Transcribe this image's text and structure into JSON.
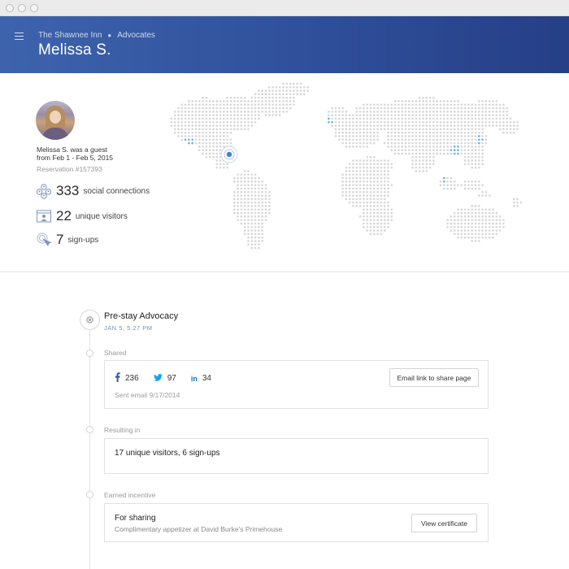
{
  "header": {
    "breadcrumb": [
      "The Shawnee Inn",
      "Advocates"
    ],
    "title": "Melissa S."
  },
  "profile": {
    "guest_line_1": "Melissa S. was a guest",
    "guest_line_2": "from Feb 1 - Feb 5, 2015",
    "reservation": "Reservation #157393",
    "stats": [
      {
        "number": "333",
        "label": "social connections",
        "icon": "people-icon"
      },
      {
        "number": "22",
        "label": "unique visitors",
        "icon": "visitor-card-icon"
      },
      {
        "number": "7",
        "label": "sign-ups",
        "icon": "cursor-click-icon"
      }
    ]
  },
  "map": {
    "icon": "world-dot-map",
    "dot_color": "#d8d8d8",
    "highlight_color": "#6fb2e8",
    "marker_color": "#3b82d6"
  },
  "timeline": {
    "title": "Pre-stay Advocacy",
    "date": "JAN 5, 5:27 PM",
    "sections": {
      "shared": {
        "label": "Shared",
        "facebook": "236",
        "twitter": "97",
        "linkedin": "34",
        "sent": "Sent email 9/17/2014",
        "button": "Email link to share page"
      },
      "resulting": {
        "label": "Resulting in",
        "text": "17 unique visitors, 6 sign-ups"
      },
      "incentive": {
        "label": "Earned incentive",
        "title": "For sharing",
        "desc": "Complimentary appetizer at David Burke's Primehouse",
        "button": "View certificate"
      }
    }
  },
  "colors": {
    "header_start": "#3e63ad",
    "header_end": "#263f87",
    "facebook": "#3b5998",
    "twitter": "#1da1f2",
    "linkedin": "#0077b5"
  }
}
